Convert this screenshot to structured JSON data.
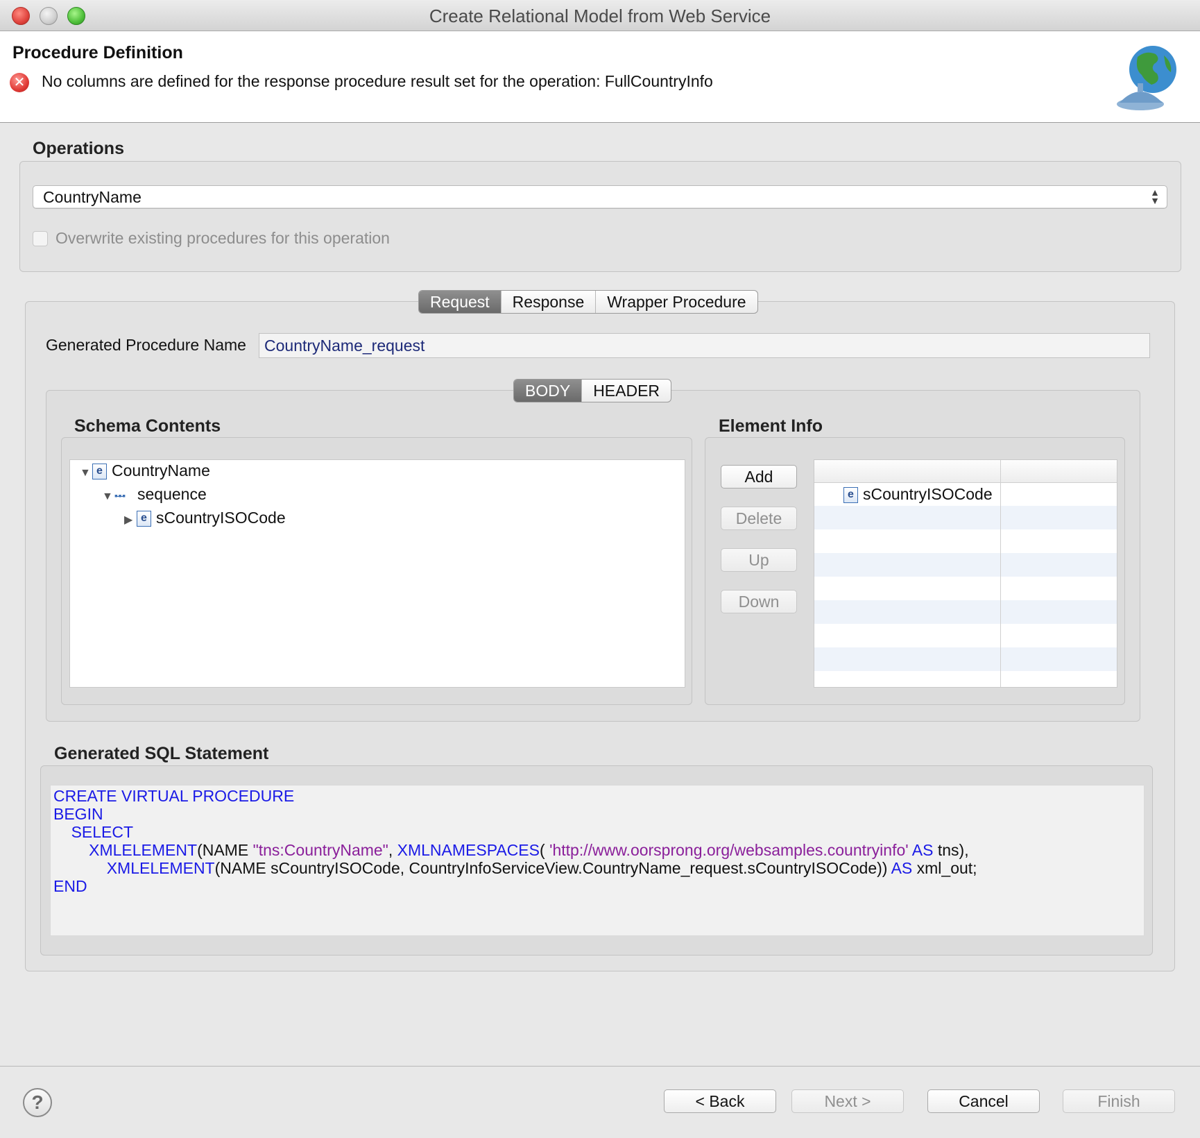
{
  "window": {
    "title": "Create Relational Model from Web Service"
  },
  "header": {
    "title": "Procedure Definition",
    "error_message": "No columns are defined for the response procedure result set for the operation: FullCountryInfo"
  },
  "operations": {
    "label": "Operations",
    "selected": "CountryName",
    "overwrite_label": "Overwrite existing procedures for this operation",
    "overwrite_checked": false
  },
  "tabs": [
    "Request",
    "Response",
    "Wrapper Procedure"
  ],
  "active_tab": "Request",
  "generated_name": {
    "label": "Generated Procedure Name",
    "value": "CountryName_request"
  },
  "subtabs": [
    "BODY",
    "HEADER"
  ],
  "active_subtab": "BODY",
  "schema": {
    "label": "Schema Contents",
    "tree": [
      {
        "label": "CountryName",
        "icon": "element-icon",
        "expanded": true
      },
      {
        "label": "sequence",
        "icon": "sequence-icon",
        "expanded": true
      },
      {
        "label": "sCountryISOCode",
        "icon": "element-icon",
        "expanded": false
      }
    ]
  },
  "element_info": {
    "label": "Element Info",
    "buttons": {
      "add": "Add",
      "delete": "Delete",
      "up": "Up",
      "down": "Down"
    },
    "rows": [
      {
        "name": "sCountryISOCode",
        "icon": "element-icon"
      }
    ]
  },
  "sql": {
    "label": "Generated SQL Statement",
    "l1": "CREATE VIRTUAL PROCEDURE",
    "l2": "BEGIN",
    "l3": "SELECT",
    "l4_kw1": "XMLELEMENT",
    "l4_t1": "(NAME ",
    "l4_s1": "\"tns:CountryName\"",
    "l4_t2": ", ",
    "l4_kw2": "XMLNAMESPACES",
    "l4_t3": "( ",
    "l4_s2": "'http://www.oorsprong.org/websamples.countryinfo'",
    "l4_t4": " ",
    "l4_kw3": "AS",
    "l4_t5": " tns),",
    "l5_kw1": "XMLELEMENT",
    "l5_t1": "(NAME sCountryISOCode, CountryInfoServiceView.CountryName_request.sCountryISOCode)) ",
    "l5_kw2": "AS",
    "l5_t2": " xml_out;",
    "l6": "END"
  },
  "footer": {
    "back": "< Back",
    "next": "Next >",
    "cancel": "Cancel",
    "finish": "Finish"
  },
  "colors": {
    "error": "#e03a36",
    "sql_keyword": "#1a1ae6",
    "sql_string": "#8a1f9a",
    "field_text": "#1d2a78"
  }
}
